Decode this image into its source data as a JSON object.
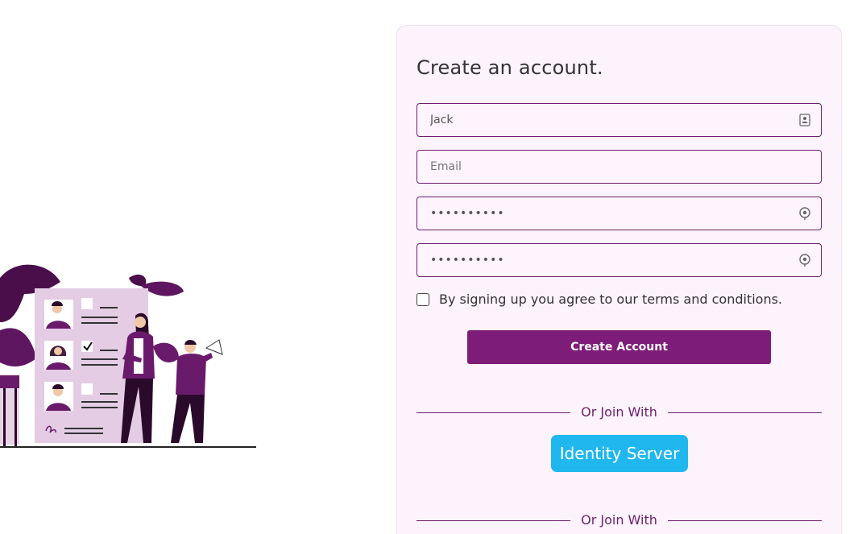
{
  "form": {
    "title": "Create an account.",
    "name_value": "Jack",
    "email_placeholder": "Email",
    "password_value": "••••••••••",
    "confirm_password_value": "••••••••••",
    "terms_text": "By signing up you agree to our terms and conditions.",
    "terms_checked": false,
    "create_button": "Create Account"
  },
  "external_login": {
    "divider_text": "Or Join With",
    "provider_button": "Identity Server",
    "divider_text_2": "Or Join With"
  },
  "icons": {
    "name_field": "contact-card-icon",
    "password_field": "password-reveal-icon",
    "confirm_password_field": "password-reveal-icon"
  },
  "colors": {
    "primary": "#7d1d79",
    "field_border": "#6f1d70",
    "card_background": "#fcf3fc",
    "identity_button": "#20b7ee"
  }
}
